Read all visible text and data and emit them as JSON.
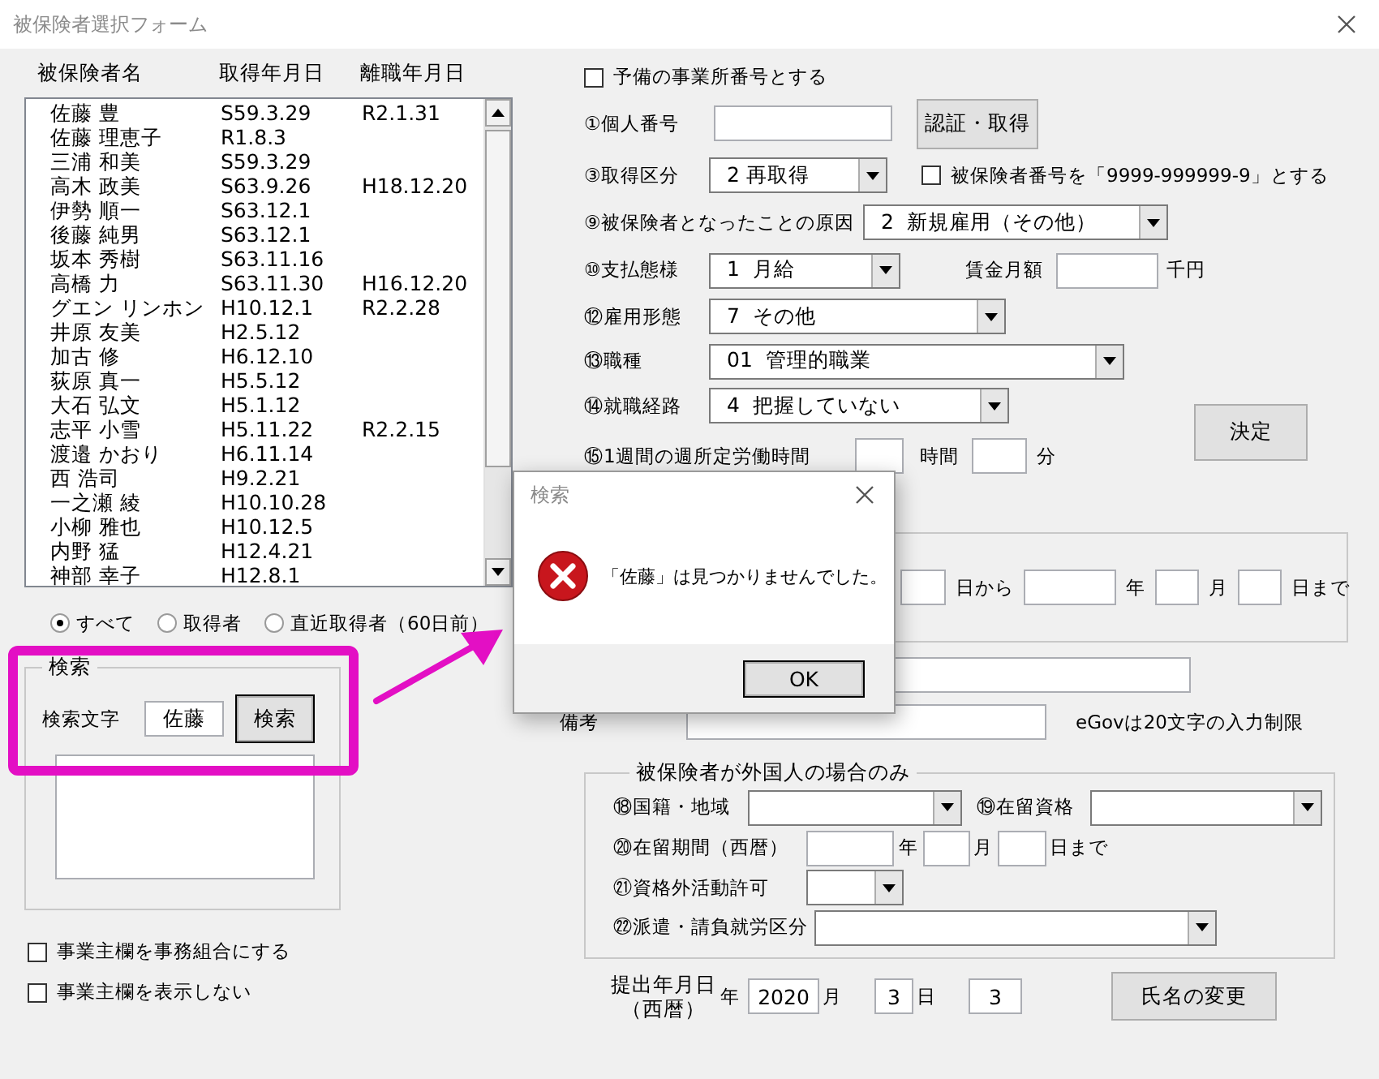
{
  "window": {
    "title": "被保険者選択フォーム"
  },
  "list": {
    "columns": [
      "被保険者名",
      "取得年月日",
      "離職年月日"
    ],
    "rows": [
      {
        "name": "佐藤 豊",
        "acquired": "S59.3.29",
        "left": "R2.1.31"
      },
      {
        "name": "佐藤 理恵子",
        "acquired": "R1.8.3",
        "left": ""
      },
      {
        "name": "三浦 和美",
        "acquired": "S59.3.29",
        "left": ""
      },
      {
        "name": "高木 政美",
        "acquired": "S63.9.26",
        "left": "H18.12.20"
      },
      {
        "name": "伊勢 順一",
        "acquired": "S63.12.1",
        "left": ""
      },
      {
        "name": "後藤 純男",
        "acquired": "S63.12.1",
        "left": ""
      },
      {
        "name": "坂本 秀樹",
        "acquired": "S63.11.16",
        "left": ""
      },
      {
        "name": "高橋 力",
        "acquired": "S63.11.30",
        "left": "H16.12.20"
      },
      {
        "name": "グエン リンホン",
        "acquired": "H10.12.1",
        "left": "R2.2.28"
      },
      {
        "name": "井原 友美",
        "acquired": "H2.5.12",
        "left": ""
      },
      {
        "name": "加古 修",
        "acquired": "H6.12.10",
        "left": ""
      },
      {
        "name": "荻原 真一",
        "acquired": "H5.5.12",
        "left": ""
      },
      {
        "name": "大石 弘文",
        "acquired": "H5.1.12",
        "left": ""
      },
      {
        "name": "志平 小雪",
        "acquired": "H5.11.22",
        "left": "R2.2.15"
      },
      {
        "name": "渡邉 かおり",
        "acquired": "H6.11.14",
        "left": ""
      },
      {
        "name": "西 浩司",
        "acquired": "H9.2.21",
        "left": ""
      },
      {
        "name": "一之瀬 綾",
        "acquired": "H10.10.28",
        "left": ""
      },
      {
        "name": "小柳 雅也",
        "acquired": "H10.12.5",
        "left": ""
      },
      {
        "name": "内野 猛",
        "acquired": "H12.4.21",
        "left": ""
      },
      {
        "name": "神部 幸子",
        "acquired": "H12.8.1",
        "left": ""
      }
    ]
  },
  "filter": [
    {
      "label": "すべて",
      "selected": true
    },
    {
      "label": "取得者",
      "selected": false
    },
    {
      "label": "直近取得者（60日前）",
      "selected": false
    }
  ],
  "search": {
    "legend": "検索",
    "label": "検索文字",
    "value": "佐藤",
    "button": "検索"
  },
  "left_checkboxes": [
    {
      "label": "事業主欄を事務組合にする",
      "checked": false
    },
    {
      "label": "事業主欄を表示しない",
      "checked": false
    }
  ],
  "main_form": {
    "reserve_office": {
      "label": "予備の事業所番号とする",
      "checked": false
    },
    "personal_number": {
      "label": "①個人番号",
      "button": "認証・取得"
    },
    "acquisition_type": {
      "label": "③取得区分",
      "value": "2 再取得",
      "checkbox": {
        "label": "被保険者番号を「9999-999999-9」とする",
        "checked": false
      }
    },
    "cause": {
      "label": "⑨被保険者となったことの原因",
      "value": "2  新規雇用（その他）"
    },
    "payment": {
      "label": "⑩支払態様",
      "value": "1  月給",
      "wage_label": "賃金月額",
      "wage_unit": "千円"
    },
    "employment": {
      "label": "⑫雇用形態",
      "value": "7  その他"
    },
    "occupation": {
      "label": "⑬職種",
      "value": "01  管理的職業"
    },
    "route": {
      "label": "⑭就職経路",
      "value": "4  把握していない"
    },
    "weekly_hours": {
      "label": "⑮1週間の週所定労働時間",
      "hours_unit": "時間",
      "minutes_unit": "分"
    },
    "decide_button": "決定",
    "period": {
      "from_suffix": "日から",
      "year": "年",
      "month": "月",
      "to_suffix": "日まで"
    },
    "remarks": {
      "label": "備考",
      "note": "eGovは20文字の入力制限"
    }
  },
  "foreigner": {
    "legend": "被保険者が外国人の場合のみ",
    "nationality": "⑱国籍・地域",
    "status": "⑲在留資格",
    "stay_period": {
      "label": "⑳在留期間（西暦）",
      "year": "年",
      "month": "月",
      "until": "日まで"
    },
    "permission": "㉑資格外活動許可",
    "dispatch": "㉒派遣・請負就労区分"
  },
  "submission": {
    "label": "提出年月日",
    "sub_label": "（西暦）",
    "year_label": "年",
    "year": "2020",
    "month_label": "月",
    "month": "3",
    "day_label": "日",
    "day": "3",
    "rename_button": "氏名の変更"
  },
  "dialog": {
    "title": "検索",
    "message": "「佐藤」は見つかりませんでした。",
    "button": "OK"
  }
}
